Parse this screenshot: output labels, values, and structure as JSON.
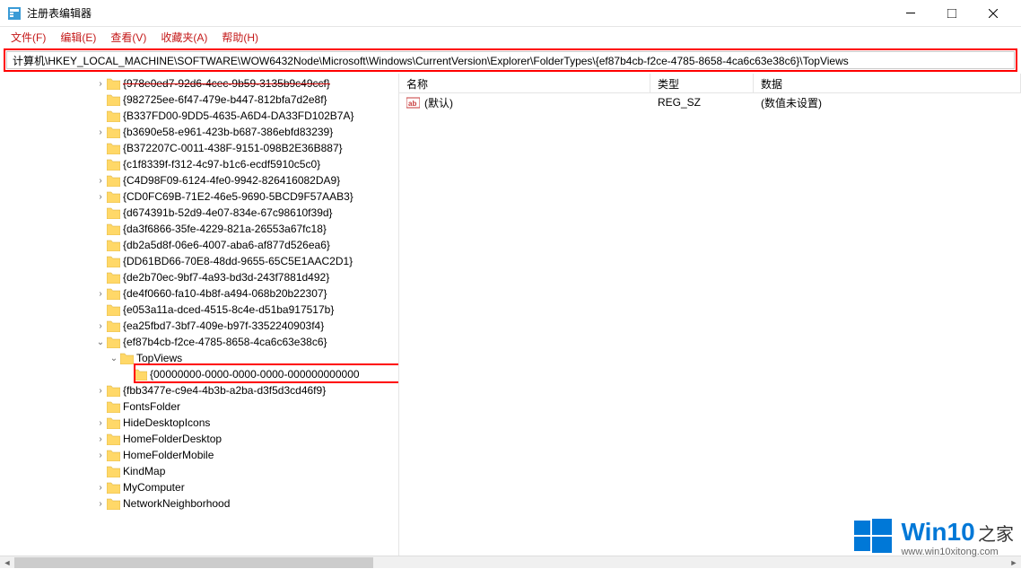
{
  "window": {
    "title": "注册表编辑器"
  },
  "menu": {
    "file": "文件(F)",
    "edit": "编辑(E)",
    "view": "查看(V)",
    "favorites": "收藏夹(A)",
    "help": "帮助(H)"
  },
  "address": {
    "value": "计算机\\HKEY_LOCAL_MACHINE\\SOFTWARE\\WOW6432Node\\Microsoft\\Windows\\CurrentVersion\\Explorer\\FolderTypes\\{ef87b4cb-f2ce-4785-8658-4ca6c63e38c6}\\TopViews"
  },
  "tree": {
    "items": [
      {
        "label": "{978e0ed7-92d6-4cec-9b59-3135b9c49ccf}",
        "level": 0,
        "exp": ">",
        "strike": true
      },
      {
        "label": "{982725ee-6f47-479e-b447-812bfa7d2e8f}",
        "level": 0,
        "exp": ""
      },
      {
        "label": "{B337FD00-9DD5-4635-A6D4-DA33FD102B7A}",
        "level": 0,
        "exp": ""
      },
      {
        "label": "{b3690e58-e961-423b-b687-386ebfd83239}",
        "level": 0,
        "exp": ">"
      },
      {
        "label": "{B372207C-0011-438F-9151-098B2E36B887}",
        "level": 0,
        "exp": ""
      },
      {
        "label": "{c1f8339f-f312-4c97-b1c6-ecdf5910c5c0}",
        "level": 0,
        "exp": ""
      },
      {
        "label": "{C4D98F09-6124-4fe0-9942-826416082DA9}",
        "level": 0,
        "exp": ">"
      },
      {
        "label": "{CD0FC69B-71E2-46e5-9690-5BCD9F57AAB3}",
        "level": 0,
        "exp": ">"
      },
      {
        "label": "{d674391b-52d9-4e07-834e-67c98610f39d}",
        "level": 0,
        "exp": ""
      },
      {
        "label": "{da3f6866-35fe-4229-821a-26553a67fc18}",
        "level": 0,
        "exp": ""
      },
      {
        "label": "{db2a5d8f-06e6-4007-aba6-af877d526ea6}",
        "level": 0,
        "exp": ""
      },
      {
        "label": "{DD61BD66-70E8-48dd-9655-65C5E1AAC2D1}",
        "level": 0,
        "exp": ""
      },
      {
        "label": "{de2b70ec-9bf7-4a93-bd3d-243f7881d492}",
        "level": 0,
        "exp": ""
      },
      {
        "label": "{de4f0660-fa10-4b8f-a494-068b20b22307}",
        "level": 0,
        "exp": ">"
      },
      {
        "label": "{e053a11a-dced-4515-8c4e-d51ba917517b}",
        "level": 0,
        "exp": ""
      },
      {
        "label": "{ea25fbd7-3bf7-409e-b97f-3352240903f4}",
        "level": 0,
        "exp": ">"
      },
      {
        "label": "{ef87b4cb-f2ce-4785-8658-4ca6c63e38c6}",
        "level": 0,
        "exp": "v"
      },
      {
        "label": "TopViews",
        "level": 1,
        "exp": "v"
      },
      {
        "label": "{00000000-0000-0000-0000-000000000000",
        "level": 2,
        "exp": ""
      },
      {
        "label": "{fbb3477e-c9e4-4b3b-a2ba-d3f5d3cd46f9}",
        "level": 0,
        "exp": ">"
      },
      {
        "label": "FontsFolder",
        "level": 0,
        "exp": ""
      },
      {
        "label": "HideDesktopIcons",
        "level": 0,
        "exp": ">"
      },
      {
        "label": "HomeFolderDesktop",
        "level": 0,
        "exp": ">"
      },
      {
        "label": "HomeFolderMobile",
        "level": 0,
        "exp": ">"
      },
      {
        "label": "KindMap",
        "level": 0,
        "exp": ""
      },
      {
        "label": "MyComputer",
        "level": 0,
        "exp": ">"
      },
      {
        "label": "NetworkNeighborhood",
        "level": 0,
        "exp": ">"
      }
    ]
  },
  "values": {
    "headers": {
      "name": "名称",
      "type": "类型",
      "data": "数据"
    },
    "rows": [
      {
        "name": "(默认)",
        "type": "REG_SZ",
        "data": "(数值未设置)"
      }
    ]
  },
  "watermark": {
    "brand": "Win10",
    "suffix": "之家",
    "url": "www.win10xitong.com"
  }
}
